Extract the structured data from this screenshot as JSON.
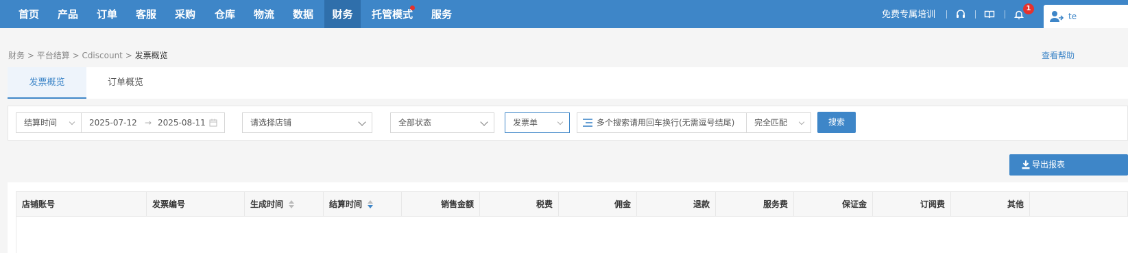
{
  "nav": {
    "items": [
      {
        "label": "首页"
      },
      {
        "label": "产品"
      },
      {
        "label": "订单"
      },
      {
        "label": "客服"
      },
      {
        "label": "采购"
      },
      {
        "label": "仓库"
      },
      {
        "label": "物流"
      },
      {
        "label": "数据"
      },
      {
        "label": "财务"
      },
      {
        "label": "托管模式"
      },
      {
        "label": "服务"
      }
    ],
    "active": "财务",
    "training_label": "免费专属培训",
    "notification_count": "1",
    "user_label": "te"
  },
  "breadcrumb": {
    "items": [
      "财务",
      "平台结算",
      "Cdiscount"
    ],
    "current": "发票概览"
  },
  "help_label": "查看帮助",
  "tabs": [
    {
      "label": "发票概览"
    },
    {
      "label": "订单概览"
    }
  ],
  "filter": {
    "time_type": "结算时间",
    "start_date": "2025-07-12",
    "end_date": "2025-08-11",
    "shop_placeholder": "请选择店铺",
    "status": "全部状态",
    "doc_type": "发票单",
    "search_placeholder": "多个搜索请用回车换行(无需逗号结尾)",
    "match_mode": "完全匹配",
    "search_label": "搜索"
  },
  "export_label": "导出报表",
  "table": {
    "columns": [
      "店铺账号",
      "发票编号",
      "生成时间",
      "结算时间",
      "销售金额",
      "税费",
      "佣金",
      "退款",
      "服务费",
      "保证金",
      "订阅费",
      "其他"
    ]
  },
  "colors": {
    "primary": "#3e86c8",
    "nav_active": "#2f6fab",
    "badge": "#e5322d"
  }
}
